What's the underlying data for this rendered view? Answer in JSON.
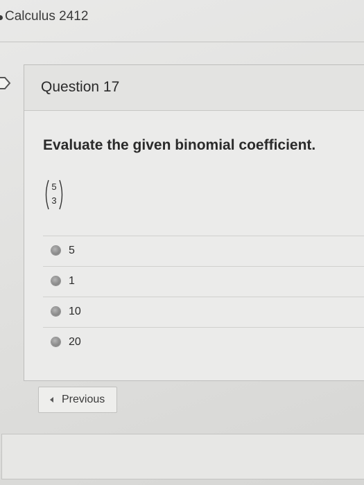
{
  "header": {
    "course_title": "Calculus 2412"
  },
  "question": {
    "title": "Question 17",
    "prompt": "Evaluate the given binomial coefficient.",
    "binomial": {
      "n": "5",
      "k": "3"
    },
    "answers": [
      {
        "label": "5"
      },
      {
        "label": "1"
      },
      {
        "label": "10"
      },
      {
        "label": "20"
      }
    ]
  },
  "navigation": {
    "previous_label": "Previous"
  }
}
